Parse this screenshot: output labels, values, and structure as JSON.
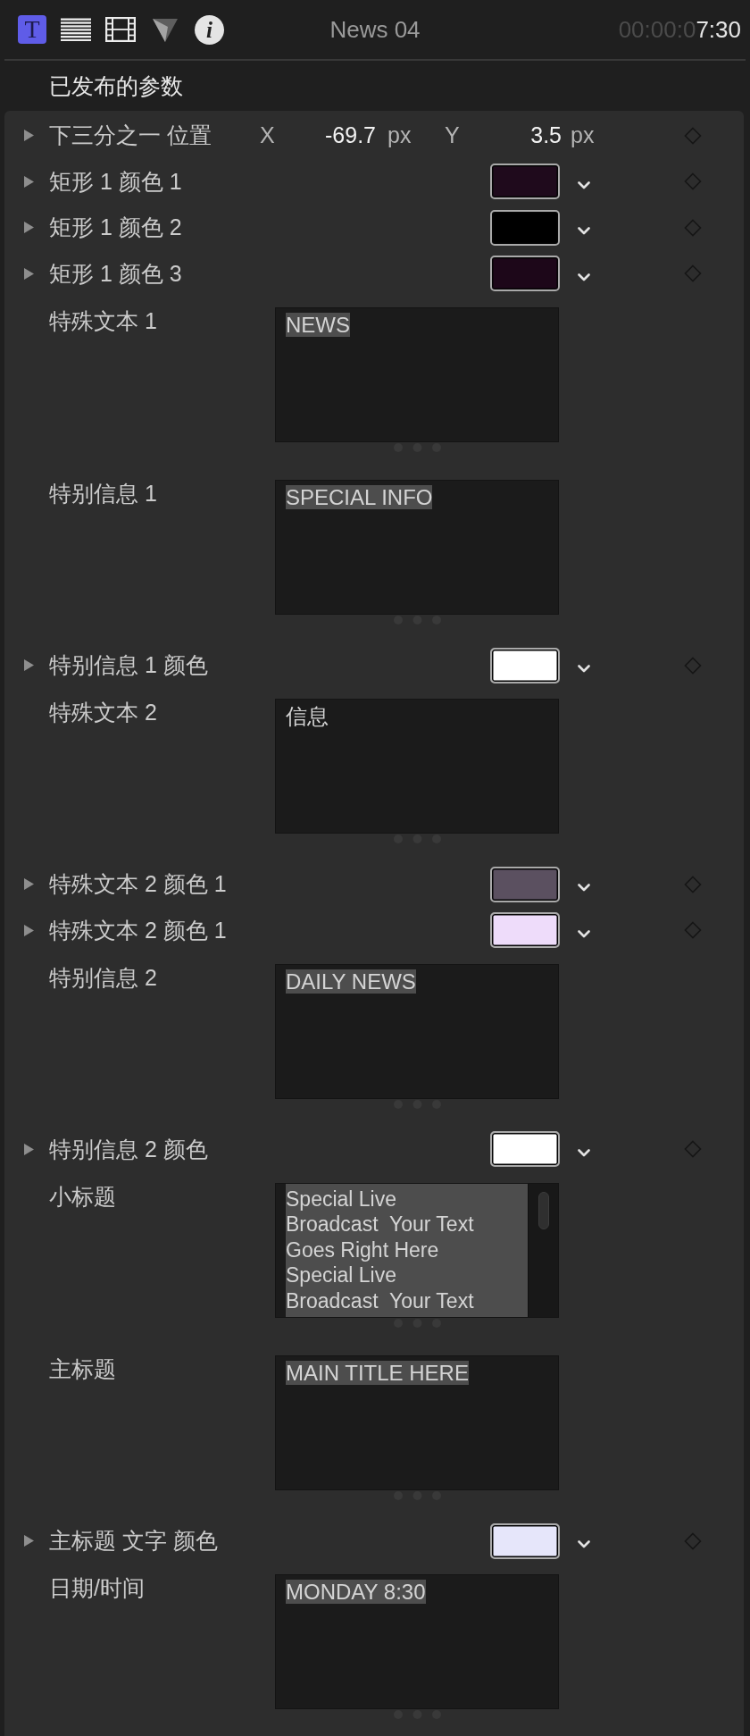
{
  "toolbar": {
    "tabs": [
      {
        "kind": "text",
        "glyph": "T",
        "selected": true
      },
      {
        "kind": "lines",
        "selected": false
      },
      {
        "kind": "film",
        "selected": false
      },
      {
        "kind": "triangle",
        "selected": false
      },
      {
        "kind": "info",
        "glyph": "i",
        "selected": false
      }
    ],
    "title": "News 04",
    "timecode": {
      "dim": "00:00:0",
      "bright": "7:30"
    }
  },
  "section_title": "已发布的参数",
  "parameters": [
    {
      "kind": "position",
      "label": "下三分之一 位置",
      "expanded": false,
      "x_label": "X",
      "x_value": "-69.7",
      "x_unit": "px",
      "y_label": "Y",
      "y_value": "3.5",
      "y_unit": "px"
    },
    {
      "kind": "color",
      "label": "矩形 1 颜色 1",
      "expanded": false,
      "color": "#1f0a1c"
    },
    {
      "kind": "color",
      "label": "矩形 1 颜色 2",
      "expanded": false,
      "color": "#000000"
    },
    {
      "kind": "color",
      "label": "矩形 1 颜色 3",
      "expanded": false,
      "color": "#1d0719"
    },
    {
      "kind": "text",
      "label": "特殊文本 1",
      "value": "NEWS",
      "text_selected": true,
      "scrollable": false
    },
    {
      "kind": "text",
      "label": "特别信息 1",
      "value": "SPECIAL INFO",
      "text_selected": true,
      "scrollable": false
    },
    {
      "kind": "color",
      "label": "特别信息 1 颜色",
      "expanded": false,
      "color": "#ffffff"
    },
    {
      "kind": "text",
      "label": "特殊文本 2",
      "value": "信息",
      "text_selected": false,
      "scrollable": false
    },
    {
      "kind": "color",
      "label": "特殊文本 2 颜色 1",
      "expanded": false,
      "color": "#5b5060"
    },
    {
      "kind": "color",
      "label": "特殊文本 2 颜色 1",
      "expanded": false,
      "color": "#eedcfa"
    },
    {
      "kind": "text",
      "label": "特别信息 2",
      "value": "DAILY NEWS",
      "text_selected": true,
      "scrollable": false
    },
    {
      "kind": "color",
      "label": "特别信息 2 颜色",
      "expanded": false,
      "color": "#ffffff"
    },
    {
      "kind": "text",
      "label": "小标题",
      "value": "Special Live\nBroadcast  Your Text\nGoes Right Here\nSpecial Live\nBroadcast  Your Text",
      "text_selected": true,
      "scrollable": true
    },
    {
      "kind": "text",
      "label": "主标题",
      "value": "MAIN TITLE HERE",
      "text_selected": true,
      "scrollable": false
    },
    {
      "kind": "color",
      "label": "主标题 文字 颜色",
      "expanded": false,
      "color": "#e6e6fa"
    },
    {
      "kind": "text",
      "label": "日期/时间",
      "value": "MONDAY 8:30",
      "text_selected": true,
      "scrollable": false
    }
  ]
}
